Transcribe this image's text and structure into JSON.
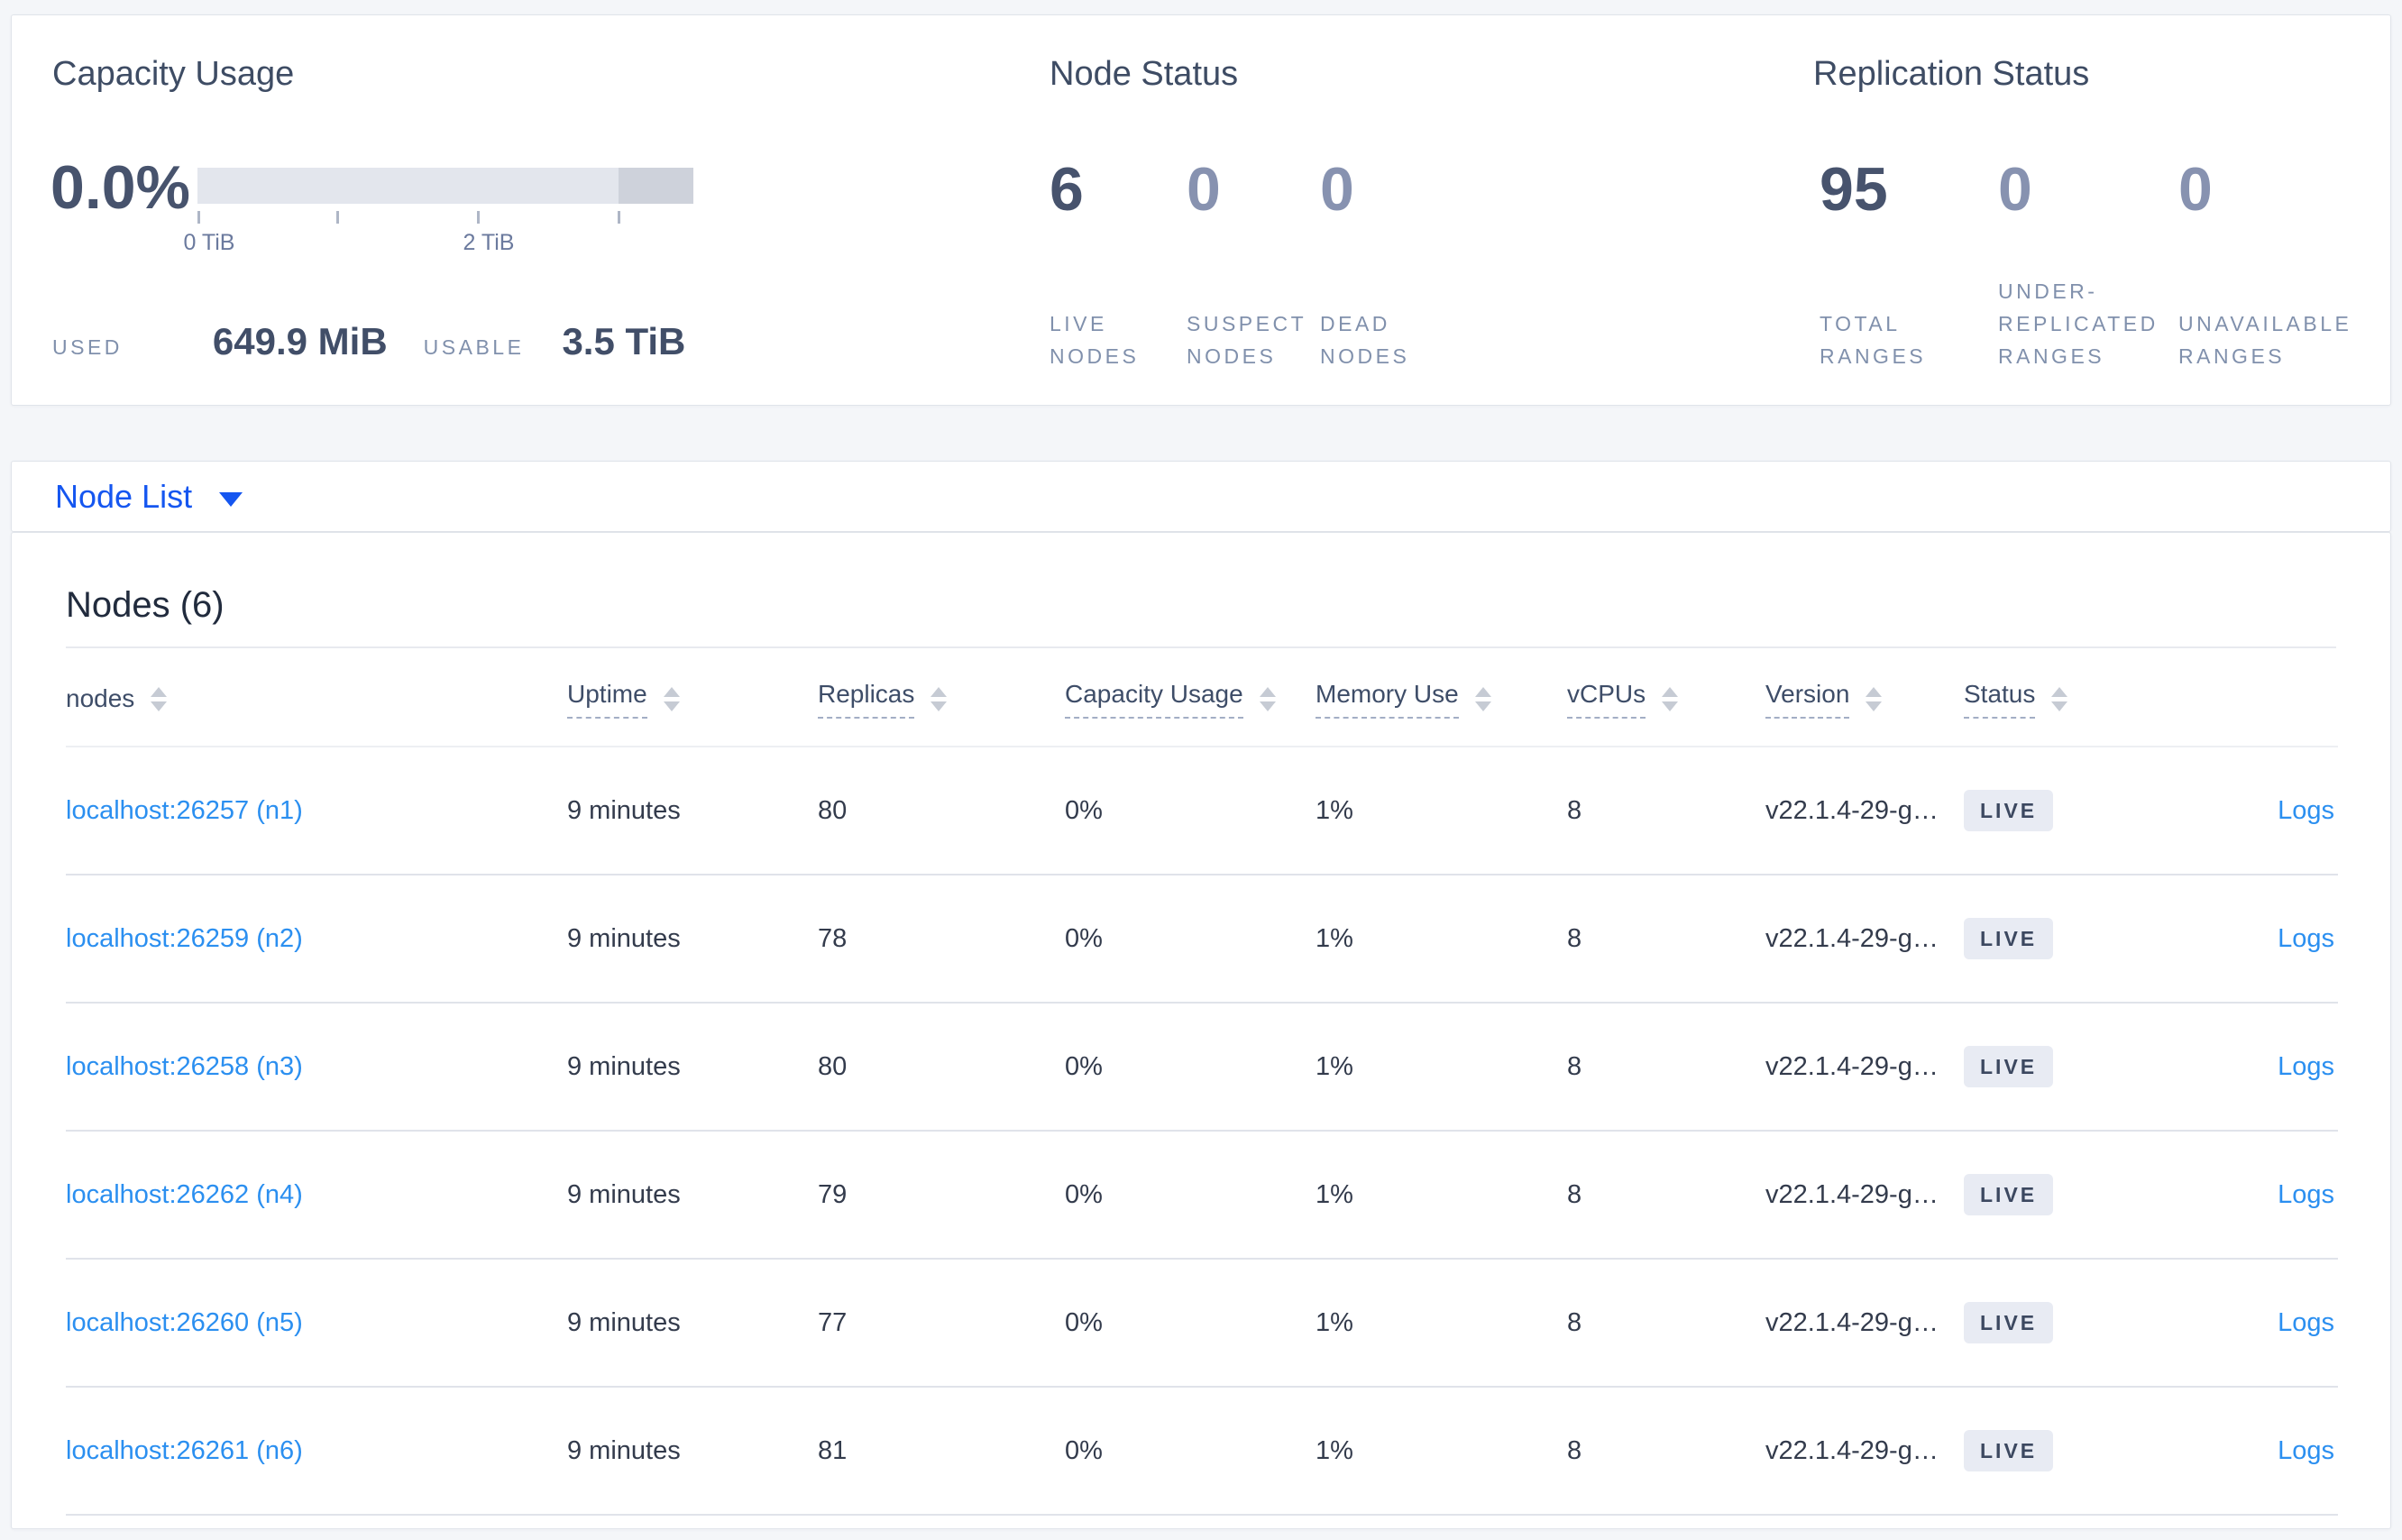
{
  "summary": {
    "capacity": {
      "title": "Capacity Usage",
      "percent": "0.0%",
      "ticks": [
        "0 TiB",
        "2 TiB"
      ],
      "used_label": "USED",
      "used_value": "649.9 MiB",
      "usable_label": "USABLE",
      "usable_value": "3.5 TiB"
    },
    "node_status": {
      "title": "Node Status",
      "stats": [
        {
          "value": "6",
          "label": "LIVE NODES"
        },
        {
          "value": "0",
          "label": "SUSPECT NODES"
        },
        {
          "value": "0",
          "label": "DEAD NODES"
        }
      ]
    },
    "replication": {
      "title": "Replication Status",
      "stats": [
        {
          "value": "95",
          "label": "TOTAL RANGES"
        },
        {
          "value": "0",
          "label": "UNDER-REPLICATED RANGES"
        },
        {
          "value": "0",
          "label": "UNAVAILABLE RANGES"
        }
      ]
    }
  },
  "node_list": {
    "selector_label": "Node List"
  },
  "nodes_section": {
    "heading": "Nodes (6)",
    "columns": [
      {
        "label": "nodes"
      },
      {
        "label": "Uptime"
      },
      {
        "label": "Replicas"
      },
      {
        "label": "Capacity Usage"
      },
      {
        "label": "Memory Use"
      },
      {
        "label": "vCPUs"
      },
      {
        "label": "Version"
      },
      {
        "label": "Status"
      }
    ],
    "rows": [
      {
        "address": "localhost:26257 (n1)",
        "uptime": "9 minutes",
        "replicas": "80",
        "capacity": "0%",
        "memory": "1%",
        "vcpus": "8",
        "version": "v22.1.4-29-g…",
        "status": "LIVE",
        "logs": "Logs"
      },
      {
        "address": "localhost:26259 (n2)",
        "uptime": "9 minutes",
        "replicas": "78",
        "capacity": "0%",
        "memory": "1%",
        "vcpus": "8",
        "version": "v22.1.4-29-g…",
        "status": "LIVE",
        "logs": "Logs"
      },
      {
        "address": "localhost:26258 (n3)",
        "uptime": "9 minutes",
        "replicas": "80",
        "capacity": "0%",
        "memory": "1%",
        "vcpus": "8",
        "version": "v22.1.4-29-g…",
        "status": "LIVE",
        "logs": "Logs"
      },
      {
        "address": "localhost:26262 (n4)",
        "uptime": "9 minutes",
        "replicas": "79",
        "capacity": "0%",
        "memory": "1%",
        "vcpus": "8",
        "version": "v22.1.4-29-g…",
        "status": "LIVE",
        "logs": "Logs"
      },
      {
        "address": "localhost:26260 (n5)",
        "uptime": "9 minutes",
        "replicas": "77",
        "capacity": "0%",
        "memory": "1%",
        "vcpus": "8",
        "version": "v22.1.4-29-g…",
        "status": "LIVE",
        "logs": "Logs"
      },
      {
        "address": "localhost:26261 (n6)",
        "uptime": "9 minutes",
        "replicas": "81",
        "capacity": "0%",
        "memory": "1%",
        "vcpus": "8",
        "version": "v22.1.4-29-g…",
        "status": "LIVE",
        "logs": "Logs"
      }
    ]
  },
  "colors": {
    "accent_blue": "#1556f0",
    "link_blue": "#2b8ff0",
    "badge_bg": "#e8ebf3",
    "bar_light": "#e3e6ed",
    "bar_dark": "#ced2db",
    "page_bg": "#f4f6f9"
  }
}
